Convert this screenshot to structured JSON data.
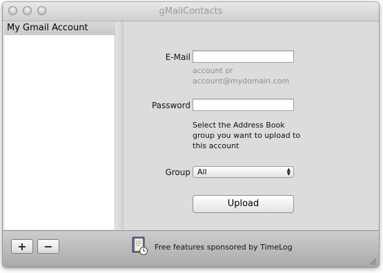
{
  "window": {
    "title": "gMailContacts"
  },
  "sidebar": {
    "items": [
      {
        "label": "My Gmail Account"
      }
    ]
  },
  "form": {
    "email": {
      "label": "E-Mail",
      "value": "",
      "placeholder": "",
      "hint_line1": "account or",
      "hint_line2": "account@mydomain.com"
    },
    "password": {
      "label": "Password",
      "value": ""
    },
    "group_description": [
      "Select the Address Book",
      "group you want to upload to",
      "this account"
    ],
    "group": {
      "label": "Group",
      "selected": "All"
    },
    "upload_label": "Upload"
  },
  "bottombar": {
    "add_label": "+",
    "remove_label": "−",
    "sponsor_text": "Free features sponsored by TimeLog"
  },
  "icons": {
    "window_controls": [
      "close-icon",
      "minimize-icon",
      "zoom-icon"
    ],
    "sponsor": "timelog-book-icon",
    "select_arrows": "up-down-arrows-icon",
    "resize": "resize-grip-icon"
  }
}
